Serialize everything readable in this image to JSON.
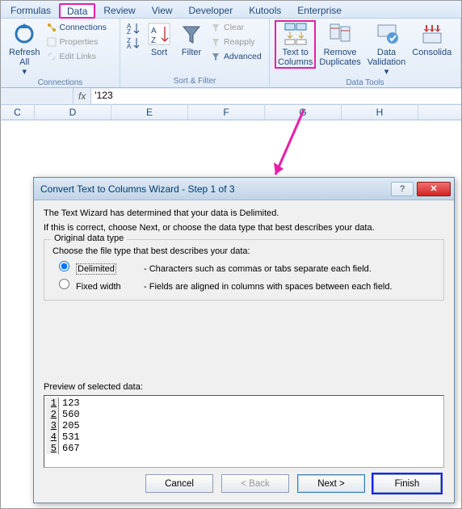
{
  "tabs": {
    "formulas": "Formulas",
    "data": "Data",
    "review": "Review",
    "view": "View",
    "developer": "Developer",
    "kutools": "Kutools",
    "enterprise": "Enterprise"
  },
  "ribbon": {
    "refresh": "Refresh\nAll",
    "connections": "Connections",
    "properties": "Properties",
    "editlinks": "Edit Links",
    "conn_group": "Connections",
    "sort": "Sort",
    "filter": "Filter",
    "clear": "Clear",
    "reapply": "Reapply",
    "advanced": "Advanced",
    "sortfilter_group": "Sort & Filter",
    "texttocolumns": "Text to\nColumns",
    "removedup": "Remove\nDuplicates",
    "datavalidation": "Data\nValidation",
    "consolidate": "Consolida",
    "datatools_group": "Data Tools"
  },
  "formula_bar": {
    "fx": "fx",
    "value": "'123"
  },
  "columns": [
    "C",
    "D",
    "E",
    "F",
    "G",
    "H"
  ],
  "dialog": {
    "title": "Convert Text to Columns Wizard - Step 1 of 3",
    "line1": "The Text Wizard has determined that your data is Delimited.",
    "line2": "If this is correct, choose Next, or choose the data type that best describes your data.",
    "fieldset_title": "Original data type",
    "choose": "Choose the file type that best describes your data:",
    "delimited": "Delimited",
    "delimited_desc": "- Characters such as commas or tabs separate each field.",
    "fixed": "Fixed width",
    "fixed_desc": "- Fields are aligned in columns with spaces between each field.",
    "preview_label": "Preview of selected data:",
    "preview_rows": [
      {
        "n": "1",
        "v": "123"
      },
      {
        "n": "2",
        "v": "560"
      },
      {
        "n": "3",
        "v": "205"
      },
      {
        "n": "4",
        "v": "531"
      },
      {
        "n": "5",
        "v": "667"
      }
    ],
    "cancel": "Cancel",
    "back": "< Back",
    "next": "Next >",
    "finish": "Finish"
  }
}
